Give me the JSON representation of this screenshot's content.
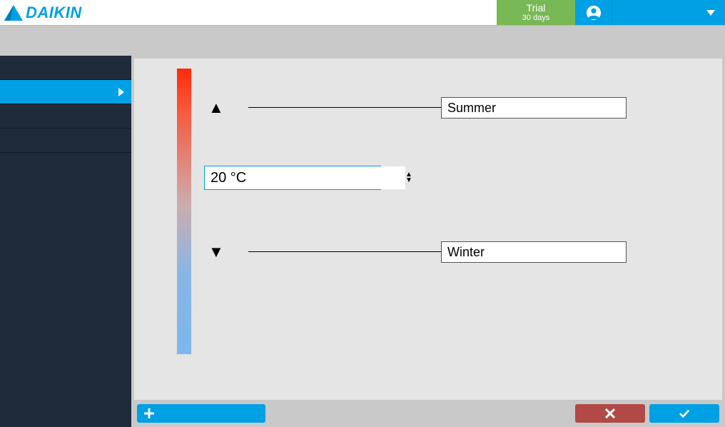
{
  "header": {
    "brand": "DAIKIN",
    "trial_label": "Trial",
    "trial_duration": "30 days"
  },
  "content": {
    "summer_label": "Summer",
    "winter_label": "Winter",
    "temperature_value": "20 °C"
  },
  "colors": {
    "accent": "#00a0e4",
    "trial_bg": "#78b855",
    "danger": "#b14946",
    "sidebar_bg": "#1f2a3a",
    "gradient_hot": "#ff2a0a",
    "gradient_cold": "#7db7ed"
  }
}
